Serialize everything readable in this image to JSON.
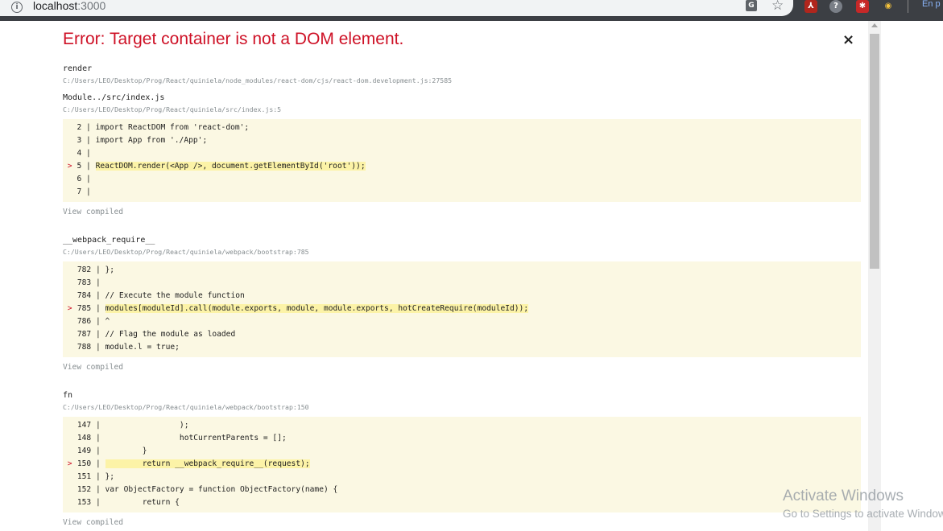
{
  "browser": {
    "url_host": "localhost",
    "url_port": ":3000",
    "language_indicator": "En p",
    "icons": {
      "site_info": "info-icon",
      "translate": "translate-icon",
      "bookmark": "star-icon",
      "extensions": [
        "pdf-extension-icon",
        "help-extension-icon",
        "red-extension-icon",
        "owl-extension-icon"
      ]
    }
  },
  "overlay": {
    "title": "Error: Target container is not a DOM element.",
    "close_label": "×",
    "view_compiled_label": "View compiled",
    "accent": "#ce1126",
    "code_background": "#fbf8e3",
    "highlight_background": "#fcf3a7"
  },
  "frames": [
    {
      "fn": "render",
      "path": "C:/Users/LEO/Desktop/Prog/React/quiniela/node_modules/react-dom/cjs/react-dom.development.js:27585",
      "code": []
    },
    {
      "fn": "Module../src/index.js",
      "path": "C:/Users/LEO/Desktop/Prog/React/quiniela/src/index.js:5",
      "code": [
        {
          "num": "2",
          "text": "import ReactDOM from 'react-dom';",
          "hl": false
        },
        {
          "num": "3",
          "text": "import App from './App';",
          "hl": false
        },
        {
          "num": "4",
          "text": "",
          "hl": false
        },
        {
          "num": "5",
          "text": "ReactDOM.render(<App />, document.getElementById('root'));",
          "hl": true
        },
        {
          "num": "6",
          "text": "",
          "hl": false
        },
        {
          "num": "7",
          "text": "",
          "hl": false
        }
      ]
    },
    {
      "fn": "__webpack_require__",
      "path": "C:/Users/LEO/Desktop/Prog/React/quiniela/webpack/bootstrap:785",
      "code": [
        {
          "num": "782",
          "text": "};",
          "hl": false
        },
        {
          "num": "783",
          "text": "",
          "hl": false
        },
        {
          "num": "784",
          "text": "// Execute the module function",
          "hl": false
        },
        {
          "num": "785",
          "text": "modules[moduleId].call(module.exports, module, module.exports, hotCreateRequire(moduleId));",
          "hl": true
        },
        {
          "num": "786",
          "text": "^",
          "hl": false
        },
        {
          "num": "787",
          "text": "// Flag the module as loaded",
          "hl": false
        },
        {
          "num": "788",
          "text": "module.l = true;",
          "hl": false
        }
      ]
    },
    {
      "fn": "fn",
      "path": "C:/Users/LEO/Desktop/Prog/React/quiniela/webpack/bootstrap:150",
      "code": [
        {
          "num": "147",
          "text": "                );",
          "hl": false
        },
        {
          "num": "148",
          "text": "                hotCurrentParents = [];",
          "hl": false
        },
        {
          "num": "149",
          "text": "        }",
          "hl": false
        },
        {
          "num": "150",
          "text": "        return __webpack_require__(request);",
          "hl": true
        },
        {
          "num": "151",
          "text": "};",
          "hl": false
        },
        {
          "num": "152",
          "text": "var ObjectFactory = function ObjectFactory(name) {",
          "hl": false
        },
        {
          "num": "153",
          "text": "        return {",
          "hl": false
        }
      ]
    }
  ],
  "watermark": {
    "title": "Activate Windows",
    "subtitle": "Go to Settings to activate Windows."
  }
}
